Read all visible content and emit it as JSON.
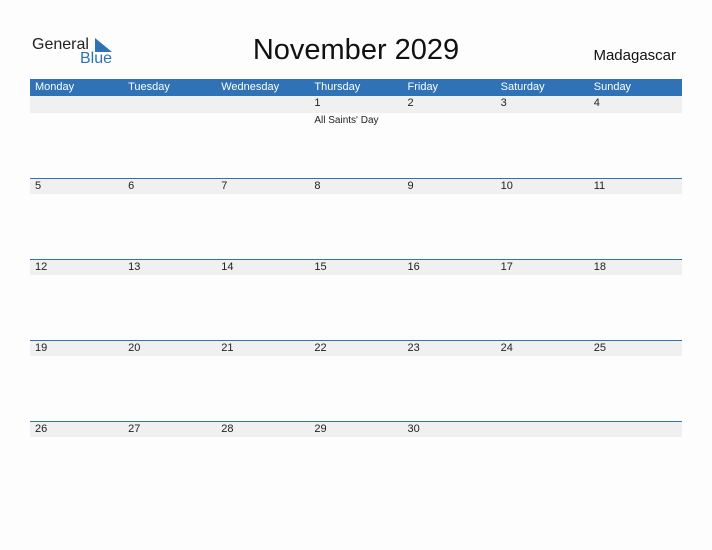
{
  "logo": {
    "general": "General",
    "blue": "Blue"
  },
  "title": "November 2029",
  "country": "Madagascar",
  "days": [
    "Monday",
    "Tuesday",
    "Wednesday",
    "Thursday",
    "Friday",
    "Saturday",
    "Sunday"
  ],
  "weeks": [
    {
      "dates": [
        "",
        "",
        "",
        "1",
        "2",
        "3",
        "4"
      ],
      "events": [
        "",
        "",
        "",
        "All Saints' Day",
        "",
        "",
        ""
      ]
    },
    {
      "dates": [
        "5",
        "6",
        "7",
        "8",
        "9",
        "10",
        "11"
      ],
      "events": [
        "",
        "",
        "",
        "",
        "",
        "",
        ""
      ]
    },
    {
      "dates": [
        "12",
        "13",
        "14",
        "15",
        "16",
        "17",
        "18"
      ],
      "events": [
        "",
        "",
        "",
        "",
        "",
        "",
        ""
      ]
    },
    {
      "dates": [
        "19",
        "20",
        "21",
        "22",
        "23",
        "24",
        "25"
      ],
      "events": [
        "",
        "",
        "",
        "",
        "",
        "",
        ""
      ]
    },
    {
      "dates": [
        "26",
        "27",
        "28",
        "29",
        "30",
        "",
        ""
      ],
      "events": [
        "",
        "",
        "",
        "",
        "",
        "",
        ""
      ]
    }
  ],
  "colors": {
    "accent": "#2f72b6",
    "row_bg": "#f0f0f0"
  }
}
